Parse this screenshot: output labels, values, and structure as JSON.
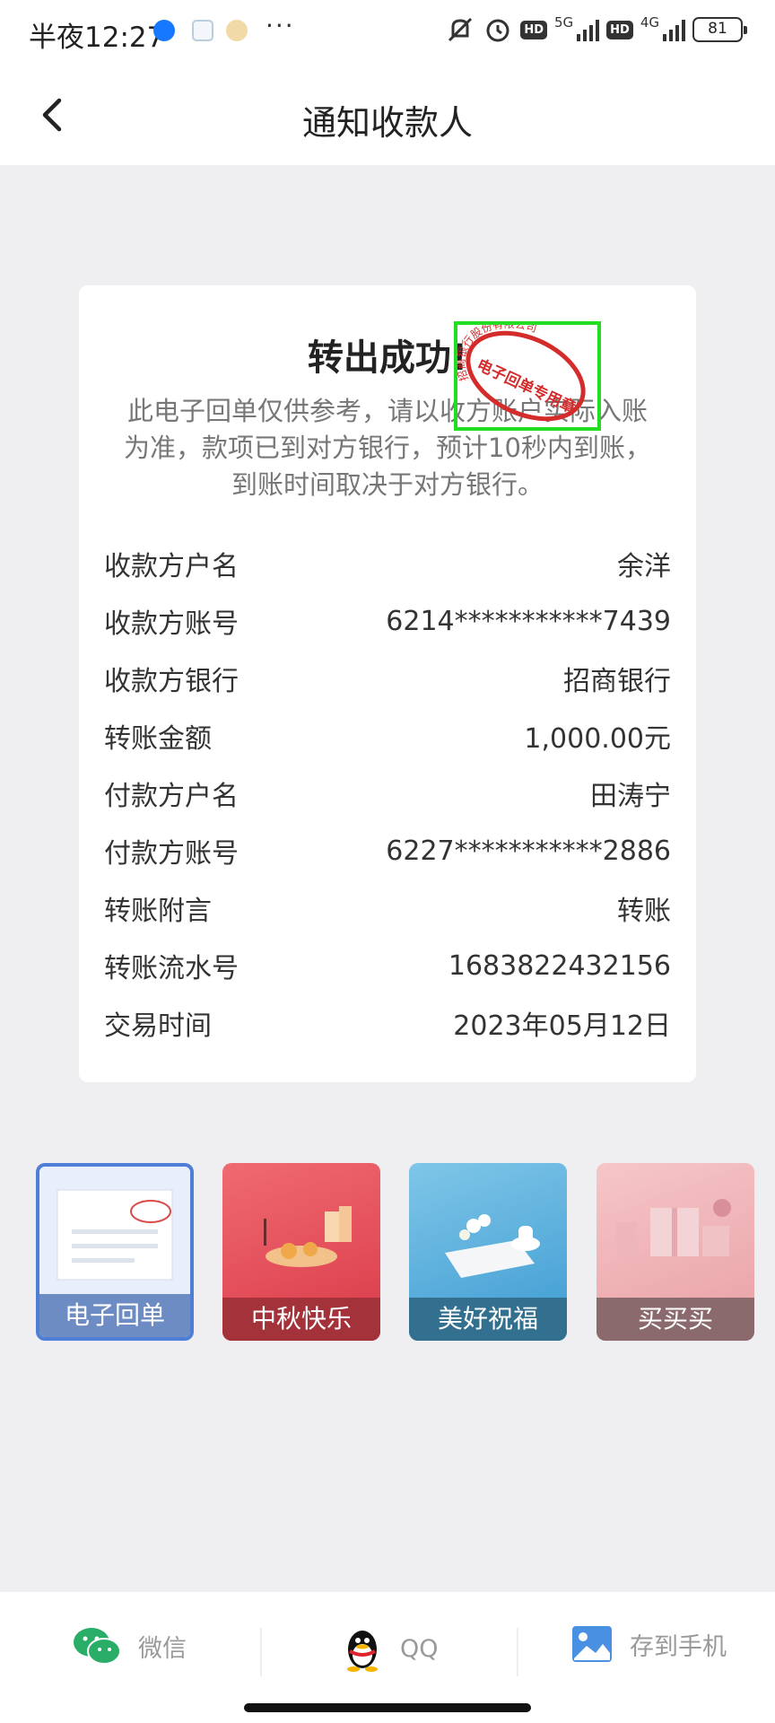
{
  "status_bar": {
    "time": "半夜12:27",
    "network_5g": "5G",
    "network_4g": "4G",
    "hd": "HD",
    "battery": "81"
  },
  "header": {
    "title": "通知收款人",
    "back_icon": "chevron-left-icon"
  },
  "receipt": {
    "title": "转出成功!",
    "note": "此电子回单仅供参考，请以收方账户实际入账为准，款项已到对方银行，预计10秒内到账，到账时间取决于对方银行。",
    "stamp_text_outer": "招商银行股份有限公司",
    "stamp_text_inner": "电子回单专用章",
    "rows": [
      {
        "label": "收款方户名",
        "value": "余洋"
      },
      {
        "label": "收款方账号",
        "value": "6214***********7439"
      },
      {
        "label": "收款方银行",
        "value": "招商银行"
      },
      {
        "label": "转账金额",
        "value": "1,000.00元"
      },
      {
        "label": "付款方户名",
        "value": "田涛宁"
      },
      {
        "label": "付款方账号",
        "value": "6227***********2886"
      },
      {
        "label": "转账附言",
        "value": "转账"
      },
      {
        "label": "转账流水号",
        "value": "1683822432156"
      },
      {
        "label": "交易时间",
        "value": "2023年05月12日"
      }
    ]
  },
  "templates": [
    {
      "label": "电子回单",
      "selected": true
    },
    {
      "label": "中秋快乐",
      "selected": false
    },
    {
      "label": "美好祝福",
      "selected": false
    },
    {
      "label": "买买买",
      "selected": false
    }
  ],
  "share": [
    {
      "label": "微信",
      "icon": "wechat-icon",
      "color": "#2aae67"
    },
    {
      "label": "QQ",
      "icon": "qq-icon",
      "color": "#111111"
    },
    {
      "label": "存到手机",
      "icon": "image-icon",
      "color": "#4a90e2"
    }
  ]
}
